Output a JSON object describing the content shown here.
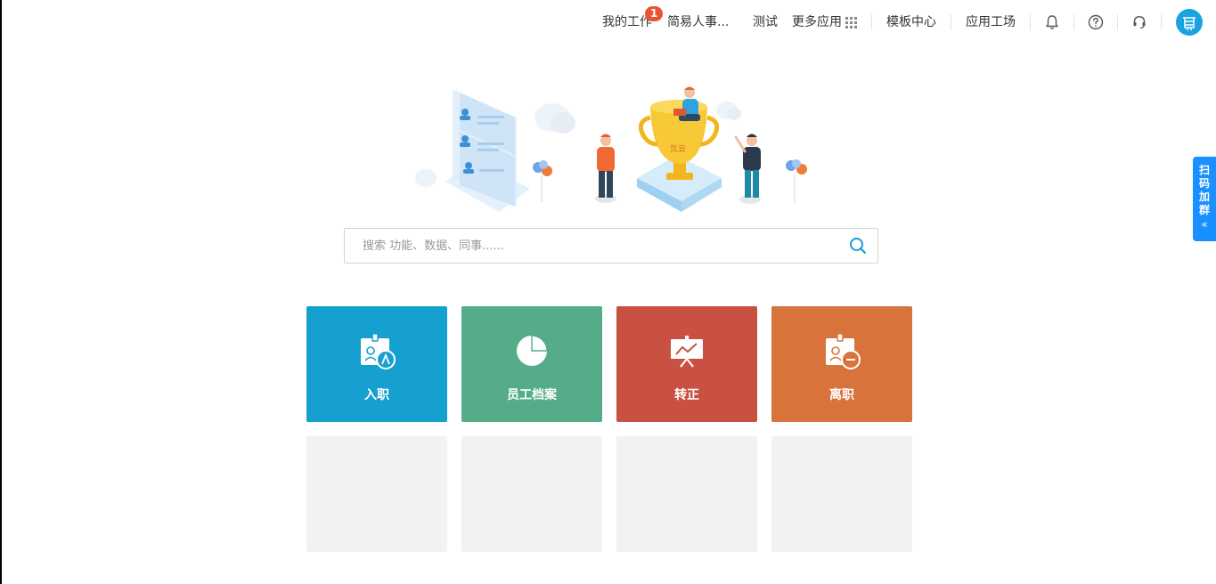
{
  "nav": {
    "my_work": "我的工作",
    "my_work_badge": "1",
    "simple_hr": "简易人事...",
    "test": "测试",
    "more_apps": "更多应用",
    "template_center": "模板中心",
    "app_workshop": "应用工场",
    "icons": [
      "bell-icon",
      "help-icon",
      "headset-icon",
      "avatar"
    ]
  },
  "side_tab": {
    "label": "扫码加群",
    "chevron": "«"
  },
  "search": {
    "placeholder": "搜索 功能、数据、同事......"
  },
  "tiles": [
    {
      "label": "入职",
      "color": "#16a0d0",
      "icon": "onboard-badge-icon"
    },
    {
      "label": "员工档案",
      "color": "#54ad88",
      "icon": "pie-chart-icon"
    },
    {
      "label": "转正",
      "color": "#c85142",
      "icon": "presentation-board-icon"
    },
    {
      "label": "离职",
      "color": "#d9733c",
      "icon": "offboard-badge-icon"
    }
  ],
  "hero_trophy_text": "氚云",
  "colors": {
    "accent": "#1890ff",
    "avatar": "#1aa3e0",
    "empty_tile": "#f1f2f2"
  }
}
